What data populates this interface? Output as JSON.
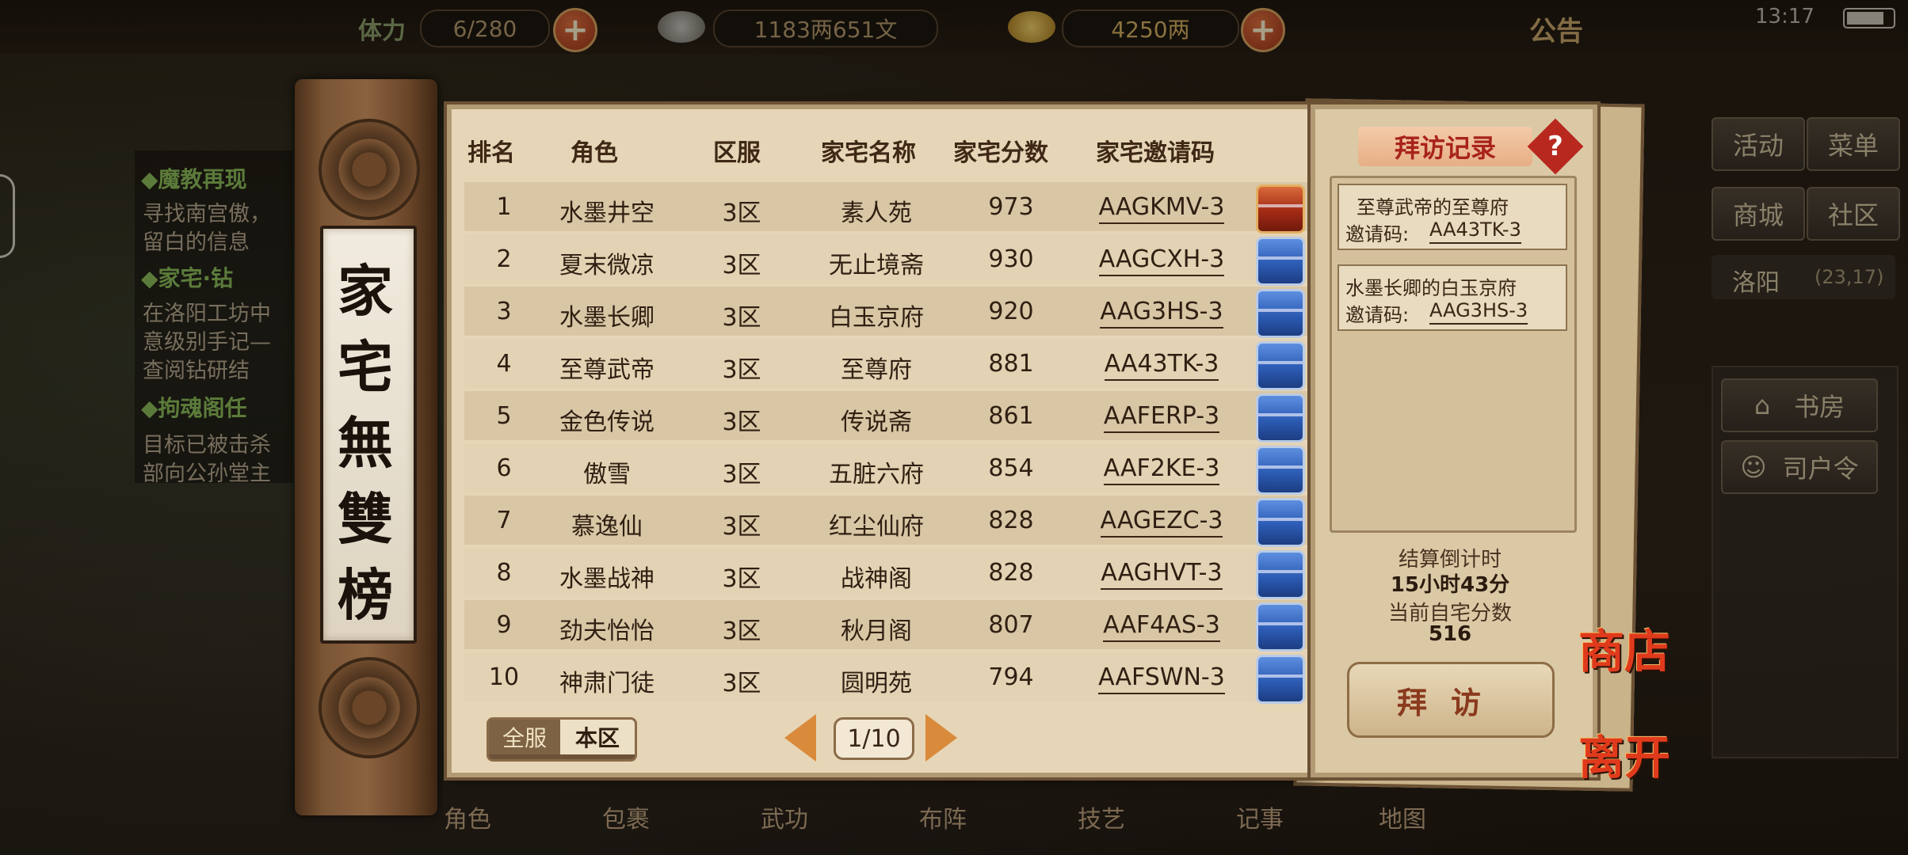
{
  "topbar": {
    "stamina_label": "体力",
    "stamina_value": "6/280",
    "money_value": "1183两651文",
    "gold_value": "4250两",
    "notice_label": "公告",
    "clock": "13:17"
  },
  "quests": [
    {
      "title": "◆魔教再现",
      "lines": [
        "寻找南宫傲，",
        "留白的信息"
      ]
    },
    {
      "title": "◆家宅·钻",
      "lines": [
        "在洛阳工坊中",
        "意级别手记—",
        "查阅钻研结"
      ]
    },
    {
      "title": "◆拘魂阁任",
      "lines": [
        "目标已被击杀",
        "部向公孙堂主"
      ]
    }
  ],
  "side_menu": {
    "activity": "活动",
    "menu": "菜单",
    "mall": "商城",
    "community": "社区",
    "location": "洛阳",
    "coords": "(23,17)",
    "study": "书房",
    "household": "司户令"
  },
  "scroll_title": [
    "家",
    "宅",
    "無",
    "雙",
    "榜"
  ],
  "table": {
    "headers": [
      "排名",
      "角色",
      "区服",
      "家宅名称",
      "家宅分数",
      "家宅邀请码"
    ],
    "rows": [
      {
        "rank": "1",
        "role": "水墨井空",
        "server": "3区",
        "home": "素人苑",
        "score": "973",
        "code": "AAGKMV-3",
        "chest": "red"
      },
      {
        "rank": "2",
        "role": "夏末微凉",
        "server": "3区",
        "home": "无止境斋",
        "score": "930",
        "code": "AAGCXH-3",
        "chest": "blue"
      },
      {
        "rank": "3",
        "role": "水墨长卿",
        "server": "3区",
        "home": "白玉京府",
        "score": "920",
        "code": "AAG3HS-3",
        "chest": "blue"
      },
      {
        "rank": "4",
        "role": "至尊武帝",
        "server": "3区",
        "home": "至尊府",
        "score": "881",
        "code": "AA43TK-3",
        "chest": "blue"
      },
      {
        "rank": "5",
        "role": "金色传说",
        "server": "3区",
        "home": "传说斋",
        "score": "861",
        "code": "AAFERP-3",
        "chest": "blue"
      },
      {
        "rank": "6",
        "role": "傲雪",
        "server": "3区",
        "home": "五脏六府",
        "score": "854",
        "code": "AAF2KE-3",
        "chest": "blue"
      },
      {
        "rank": "7",
        "role": "慕逸仙",
        "server": "3区",
        "home": "红尘仙府",
        "score": "828",
        "code": "AAGEZC-3",
        "chest": "blue"
      },
      {
        "rank": "8",
        "role": "水墨战神",
        "server": "3区",
        "home": "战神阁",
        "score": "828",
        "code": "AAGHVT-3",
        "chest": "blue"
      },
      {
        "rank": "9",
        "role": "劲夫怡怡",
        "server": "3区",
        "home": "秋月阁",
        "score": "807",
        "code": "AAF4AS-3",
        "chest": "blue"
      },
      {
        "rank": "10",
        "role": "神肃门徒",
        "server": "3区",
        "home": "圆明苑",
        "score": "794",
        "code": "AAFSWN-3",
        "chest": "blue"
      }
    ]
  },
  "filter": {
    "all": "全服",
    "local": "本区"
  },
  "pagination": {
    "page": "1/10"
  },
  "records": {
    "title": "拜访记录",
    "help": "?",
    "items": [
      {
        "name": "至尊武帝的至尊府",
        "code_label": "邀请码:",
        "code": "AA43TK-3"
      },
      {
        "name": "水墨长卿的白玉京府",
        "code_label": "邀请码:",
        "code": "AAG3HS-3"
      }
    ],
    "countdown_label": "结算倒计时",
    "countdown_value": "15小时43分",
    "score_label": "当前自宅分数",
    "score_value": "516",
    "visit": "拜访"
  },
  "shop_label": "商店",
  "leave_label": "离开",
  "bottom_nav": [
    "角色",
    "包裹",
    "武功",
    "布阵",
    "技艺",
    "记事",
    "地图"
  ],
  "colors": {
    "board": "#e6d6b7",
    "accent_red": "#a8231b",
    "chest_blue": "#2d5cb5",
    "chest_red": "#a32a15"
  }
}
